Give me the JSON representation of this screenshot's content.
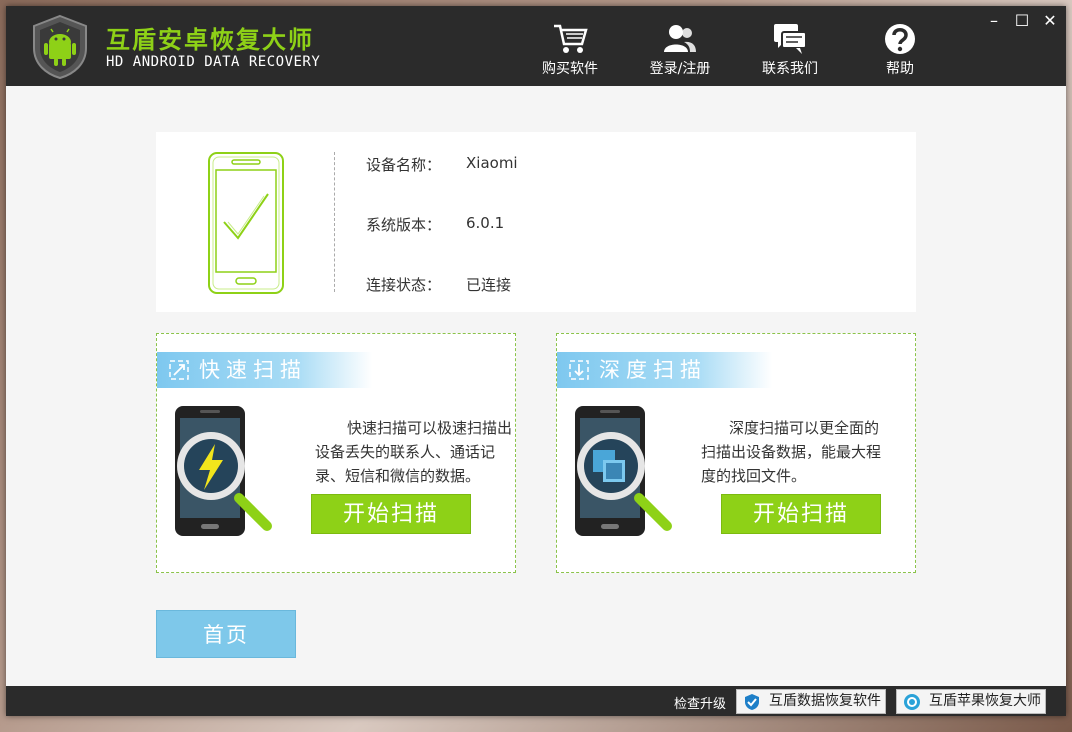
{
  "header": {
    "title": "互盾安卓恢复大师",
    "subtitle": "HD ANDROID DATA RECOVERY",
    "nav": [
      {
        "label": "购买软件",
        "icon": "cart-icon"
      },
      {
        "label": "登录/注册",
        "icon": "user-icon"
      },
      {
        "label": "联系我们",
        "icon": "chat-icon"
      },
      {
        "label": "帮助",
        "icon": "help-icon"
      }
    ],
    "window_controls": {
      "minimize": "–",
      "maximize": "☐",
      "close": "✕"
    }
  },
  "device": {
    "name_label": "设备名称：",
    "name_value": "Xiaomi",
    "version_label": "系统版本：",
    "version_value": "6.0.1",
    "status_label": "连接状态：",
    "status_value": "已连接"
  },
  "quick_scan": {
    "title": "快速扫描",
    "description_lines": [
      "快速扫描可以极速扫描出",
      "设备丢失的联系人、通话记",
      "录、短信和微信的数据。"
    ],
    "button": "开始扫描"
  },
  "deep_scan": {
    "title": "深度扫描",
    "description_lines": [
      "深度扫描可以更全面的",
      "扫描出设备数据，能最大程",
      "度的找回文件。"
    ],
    "button": "开始扫描"
  },
  "home_button": "首页",
  "footer": {
    "upgrade": "检查升级",
    "data_recovery": "互盾数据恢复软件",
    "apple_recovery": "互盾苹果恢复大师"
  },
  "colors": {
    "accent_green": "#8ed117",
    "banner_blue": "#7ec8ef",
    "titlebar": "#2b2b2b"
  }
}
